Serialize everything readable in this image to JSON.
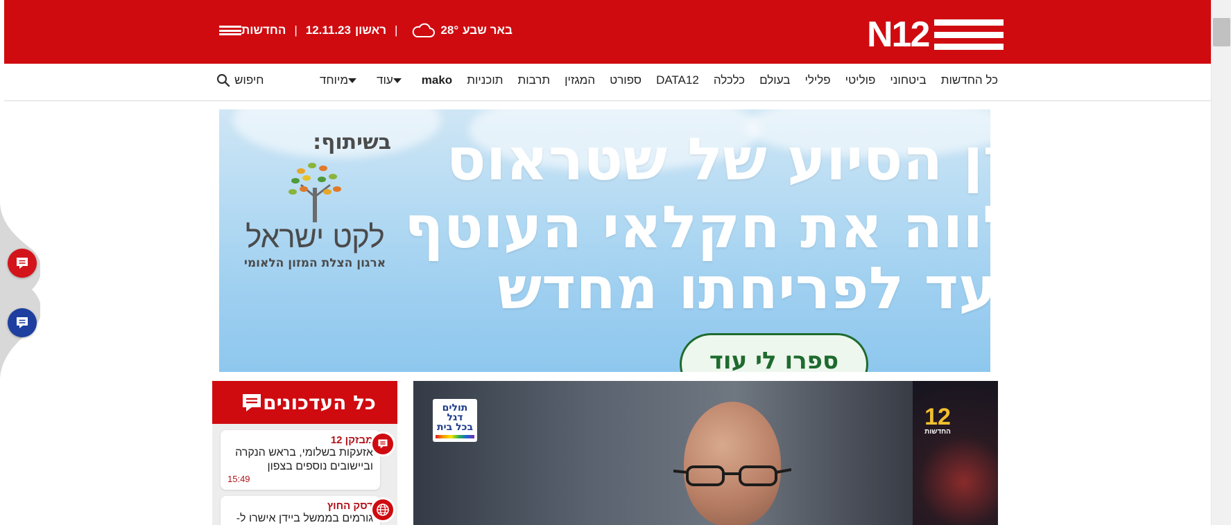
{
  "header": {
    "brand_text": "N12",
    "news_label": "החדשות",
    "date": "12.11.23",
    "day": "ראשון",
    "separator": "|",
    "weather_temp": "28°",
    "weather_city": "באר שבע",
    "weather_icon": "cloud-icon"
  },
  "nav": {
    "items": [
      {
        "label": "כל החדשות",
        "bold": false
      },
      {
        "label": "ביטחוני",
        "bold": false
      },
      {
        "label": "פוליטי",
        "bold": false
      },
      {
        "label": "פלילי",
        "bold": false
      },
      {
        "label": "בעולם",
        "bold": false
      },
      {
        "label": "כלכלה",
        "bold": false
      },
      {
        "label": "DATA12",
        "bold": false
      },
      {
        "label": "ספורט",
        "bold": false
      },
      {
        "label": "המגזין",
        "bold": false
      },
      {
        "label": "תרבות",
        "bold": false
      },
      {
        "label": "תוכניות",
        "bold": false
      },
      {
        "label": "mako",
        "bold": true
      },
      {
        "label": "עוד",
        "bold": false,
        "dropdown": true
      },
      {
        "label": "מיוחד",
        "bold": false,
        "dropdown": true
      }
    ],
    "search_label": "חיפוש"
  },
  "ad": {
    "headline_lines": [
      "רן הסיוע של שטראוס",
      "לווה את חקלאי העוטף",
      "עד לפריחתו מחדש"
    ],
    "partner_title": "בשיתוף:",
    "partner_org": "לקט ישראל",
    "partner_tagline": "ארגון הצלת המזון הלאומי",
    "cta": "ספרו לי עוד"
  },
  "updates": {
    "title": "כל העדכונים",
    "items": [
      {
        "source": "מבזקן 12",
        "text": "אזעקות בשלומי, בראש הנקרה וביישובים נוספים בצפון",
        "time": "15:49",
        "icon": "chat-icon"
      },
      {
        "source": "דסק החוץ",
        "text": "גורמים בממשל ביידן אישרו ל-",
        "time": "",
        "icon": "globe-icon"
      }
    ]
  },
  "video": {
    "left_badge_lines": [
      "תולים",
      "דגל",
      "בכל בית"
    ],
    "right_badge_number": "12",
    "right_badge_label": "החדשות"
  },
  "colors": {
    "brand_red": "#cf0b10",
    "accent_blue": "#1e3fa0",
    "text_dark": "#222222"
  }
}
